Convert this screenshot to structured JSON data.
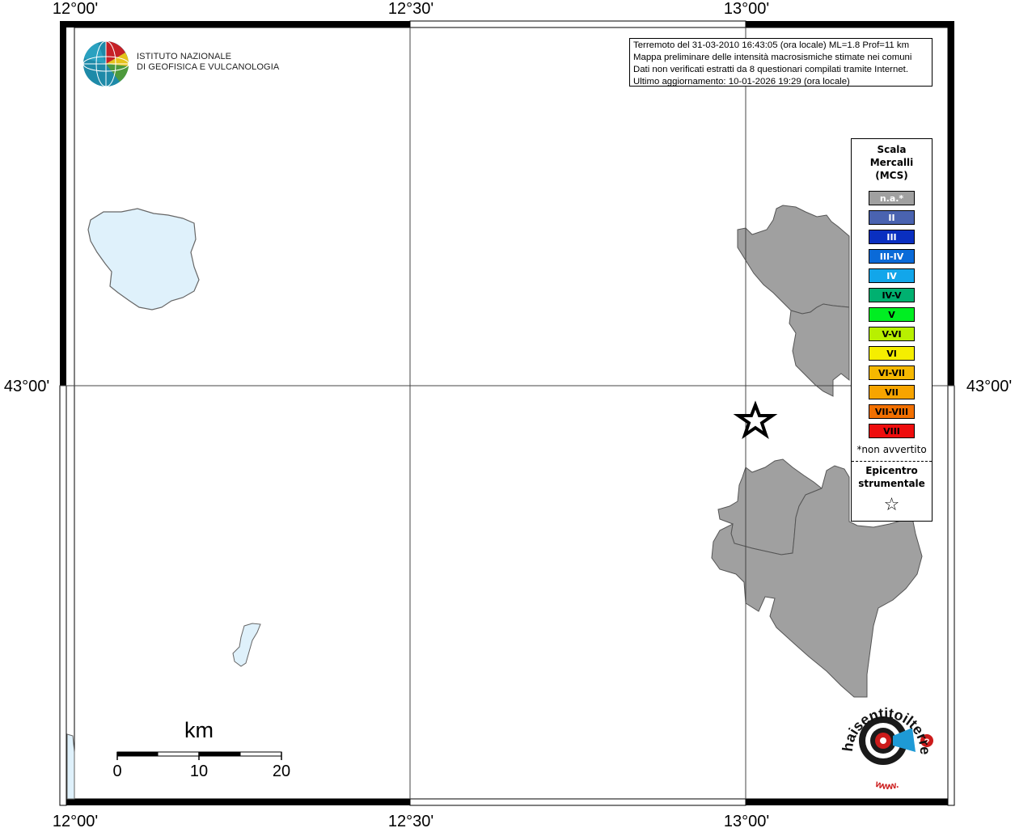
{
  "axes": {
    "top_labels": [
      "12°00'",
      "12°30'",
      "13°00'"
    ],
    "bottom_labels": [
      "12°00'",
      "12°30'",
      "13°00'"
    ],
    "left_labels": [
      "43°00'"
    ],
    "right_labels": [
      "43°00'"
    ]
  },
  "logo": {
    "line1": "ISTITUTO NAZIONALE",
    "line2": "DI GEOFISICA E VULCANOLOGIA"
  },
  "info": {
    "line1": "Terremoto del 31-03-2010 16:43:05 (ora locale) ML=1.8 Prof=11 km",
    "line2": "Mappa preliminare delle intensità macrosismiche stimate nei comuni",
    "line3": "Dati non verificati estratti da 8 questionari compilati tramite Internet.",
    "line4": "Ultimo aggiornamento: 10-01-2026 19:29 (ora locale)"
  },
  "legend": {
    "title_line1": "Scala",
    "title_line2": "Mercalli",
    "title_line3": "(MCS)",
    "items": [
      {
        "label": "n.a.*",
        "color": "#a0a0a0"
      },
      {
        "label": "II",
        "color": "#4a63b0"
      },
      {
        "label": "III",
        "color": "#0a2fc0"
      },
      {
        "label": "III-IV",
        "color": "#0a6ad8"
      },
      {
        "label": "IV",
        "color": "#12a6ea"
      },
      {
        "label": "IV-V",
        "color": "#00b070"
      },
      {
        "label": "V",
        "color": "#00ee22"
      },
      {
        "label": "V-VI",
        "color": "#b8f000"
      },
      {
        "label": "VI",
        "color": "#f5ee00"
      },
      {
        "label": "VI-VII",
        "color": "#f5b800"
      },
      {
        "label": "VII",
        "color": "#f7a400"
      },
      {
        "label": "VII-VIII",
        "color": "#f27000"
      },
      {
        "label": "VIII",
        "color": "#ee0d0d"
      }
    ],
    "note": "*non avvertito",
    "epicentro_line1": "Epicentro",
    "epicentro_line2": "strumentale"
  },
  "scalebar": {
    "title": "km",
    "labels": [
      "0",
      "10",
      "20"
    ]
  },
  "badge": {
    "text": "haisentitoilterremoto.it",
    "www": "www."
  }
}
